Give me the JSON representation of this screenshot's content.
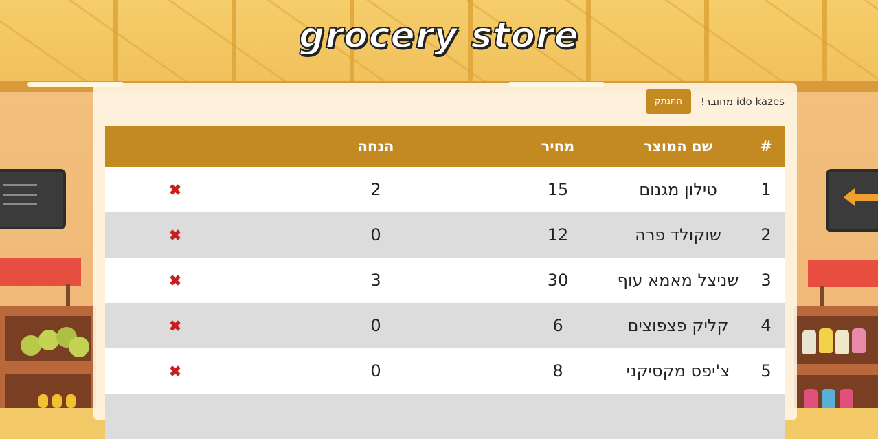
{
  "header": {
    "title": "grocery store"
  },
  "user": {
    "connected_text": "ido kazes מחובר!",
    "disconnect_label": "התנתק"
  },
  "table": {
    "headers": [
      "#",
      "שם המוצר",
      "מחיר",
      "הנחה",
      ""
    ],
    "rows": [
      {
        "num": "1",
        "name": "טילון מגנום",
        "price": "15",
        "discount": "2",
        "delete_icon": "✖"
      },
      {
        "num": "2",
        "name": "שוקולד פרה",
        "price": "12",
        "discount": "0",
        "delete_icon": "✖"
      },
      {
        "num": "3",
        "name": "שניצל מאמא עוף",
        "price": "30",
        "discount": "3",
        "delete_icon": "✖"
      },
      {
        "num": "4",
        "name": "קליק פצפוצים",
        "price": "6",
        "discount": "0",
        "delete_icon": "✖"
      },
      {
        "num": "5",
        "name": "צ'יפס מקסיקני",
        "price": "8",
        "discount": "0",
        "delete_icon": "✖"
      }
    ]
  },
  "colors": {
    "accent": "#c48a22",
    "delete": "#d11a1a",
    "row_alt": "#dcdcdc"
  }
}
